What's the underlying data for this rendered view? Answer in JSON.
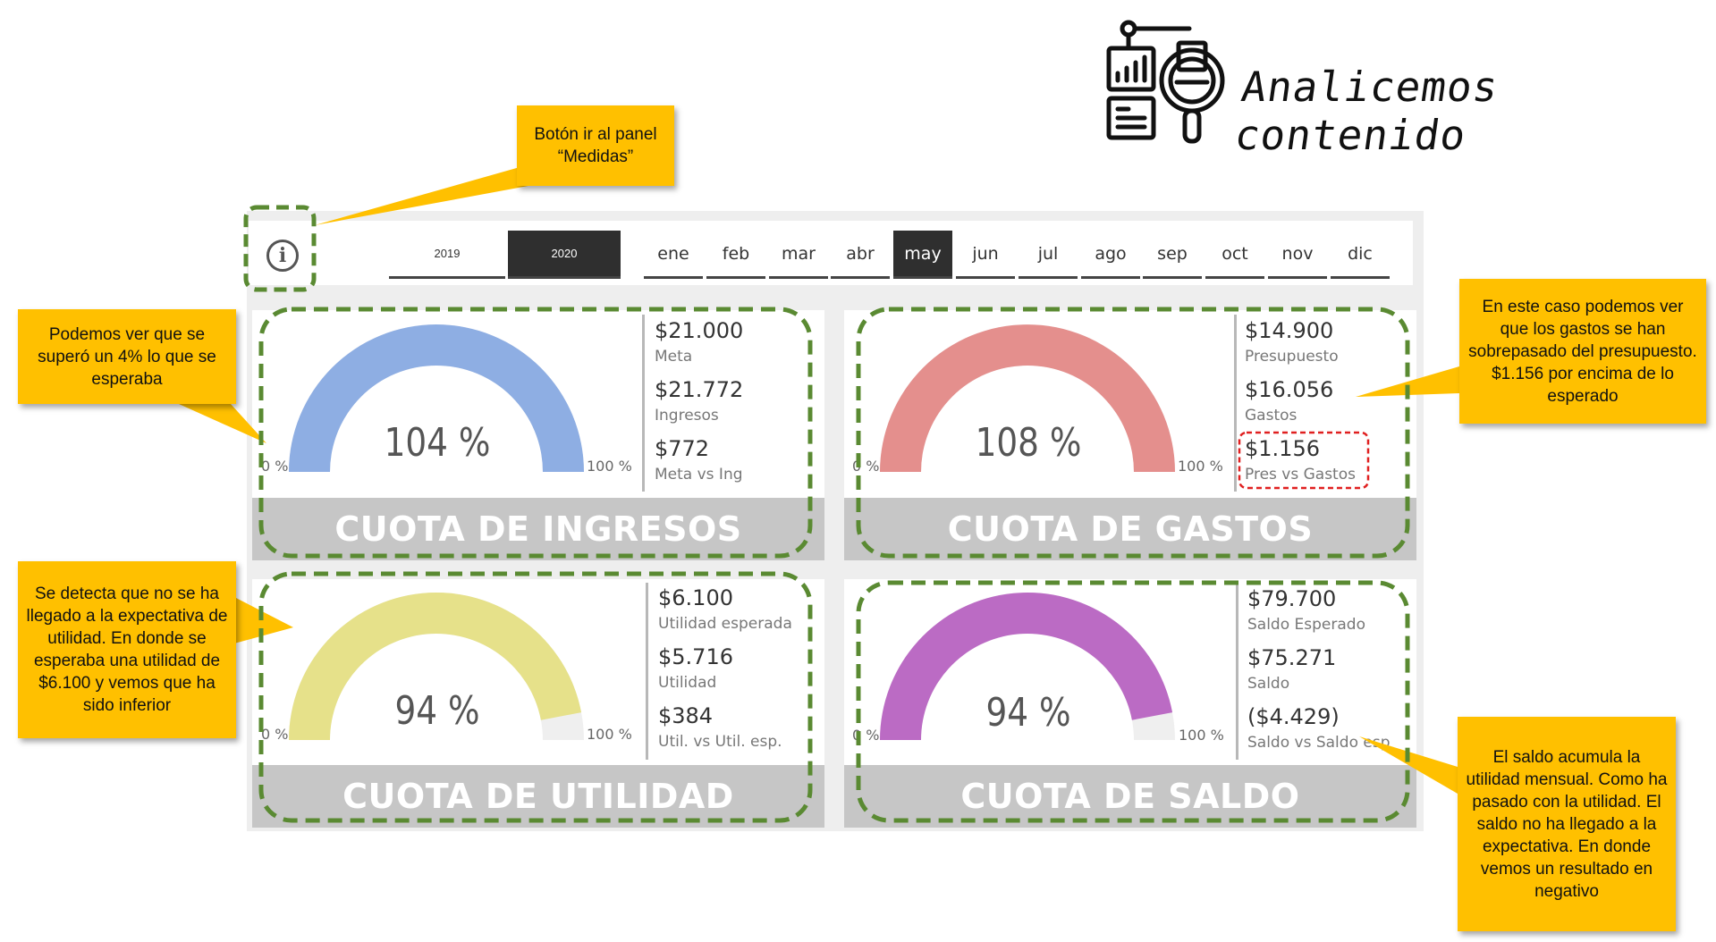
{
  "header": {
    "title": "Analicemos contenido",
    "icon": "analytics-magnifier-icon"
  },
  "info_button": {
    "icon": "info-icon",
    "glyph": "i"
  },
  "years": [
    {
      "label": "2019",
      "selected": false
    },
    {
      "label": "2020",
      "selected": true
    }
  ],
  "months": [
    {
      "label": "ene",
      "selected": false
    },
    {
      "label": "feb",
      "selected": false
    },
    {
      "label": "mar",
      "selected": false
    },
    {
      "label": "abr",
      "selected": false
    },
    {
      "label": "may",
      "selected": true
    },
    {
      "label": "jun",
      "selected": false
    },
    {
      "label": "jul",
      "selected": false
    },
    {
      "label": "ago",
      "selected": false
    },
    {
      "label": "sep",
      "selected": false
    },
    {
      "label": "oct",
      "selected": false
    },
    {
      "label": "nov",
      "selected": false
    },
    {
      "label": "dic",
      "selected": false
    }
  ],
  "cards": {
    "ingresos": {
      "title": "CUOTA DE INGRESOS",
      "gauge": {
        "percent_label": "104 %",
        "value_pct": 104,
        "min_label": "0 %",
        "max_label": "100 %",
        "color": "#8eaee3"
      },
      "kpis": [
        {
          "value": "$21.000",
          "label": "Meta"
        },
        {
          "value": "$21.772",
          "label": "Ingresos"
        },
        {
          "value": "$772",
          "label": "Meta vs Ing"
        }
      ]
    },
    "gastos": {
      "title": "CUOTA DE GASTOS",
      "gauge": {
        "percent_label": "108 %",
        "value_pct": 108,
        "min_label": "0 %",
        "max_label": "100 %",
        "color": "#e48f8d"
      },
      "kpis": [
        {
          "value": "$14.900",
          "label": "Presupuesto"
        },
        {
          "value": "$16.056",
          "label": "Gastos"
        },
        {
          "value": "$1.156",
          "label": "Pres vs Gastos"
        }
      ]
    },
    "utilidad": {
      "title": "CUOTA DE UTILIDAD",
      "gauge": {
        "percent_label": "94 %",
        "value_pct": 94,
        "min_label": "0 %",
        "max_label": "100 %",
        "color": "#e6e18a"
      },
      "kpis": [
        {
          "value": "$6.100",
          "label": "Utilidad esperada"
        },
        {
          "value": "$5.716",
          "label": "Utilidad"
        },
        {
          "value": "$384",
          "label": "Util. vs Util. esp."
        }
      ]
    },
    "saldo": {
      "title": "CUOTA DE SALDO",
      "gauge": {
        "percent_label": "94 %",
        "value_pct": 94,
        "min_label": "0 %",
        "max_label": "100 %",
        "color": "#bb6bc4"
      },
      "kpis": [
        {
          "value": "$79.700",
          "label": "Saldo Esperado"
        },
        {
          "value": "$75.271",
          "label": "Saldo"
        },
        {
          "value": "($4.429)",
          "label": "Saldo vs Saldo esp"
        }
      ]
    }
  },
  "callouts": {
    "boton": "Botón ir al panel “Medidas”",
    "ingresos": "Podemos ver que se superó un 4% lo que se esperaba",
    "gastos": "En este caso podemos ver que los gastos se han sobrepasado del presupuesto. $1.156 por encima de lo esperado",
    "utilidad": "Se detecta que no se ha llegado a la expectativa de utilidad. En donde se esperaba una utilidad de $6.100 y vemos que ha sido inferior",
    "saldo": "El saldo acumula la utilidad mensual. Como ha pasado con la utilidad. El saldo no ha llegado a la expectativa. En donde vemos un resultado en negativo"
  },
  "colors": {
    "callout": "#ffc000",
    "highlight_dash": "#5a8a32",
    "alert_dash": "#e02020",
    "card_footer": "#c6c6c6",
    "gauge_track": "#efefef"
  }
}
